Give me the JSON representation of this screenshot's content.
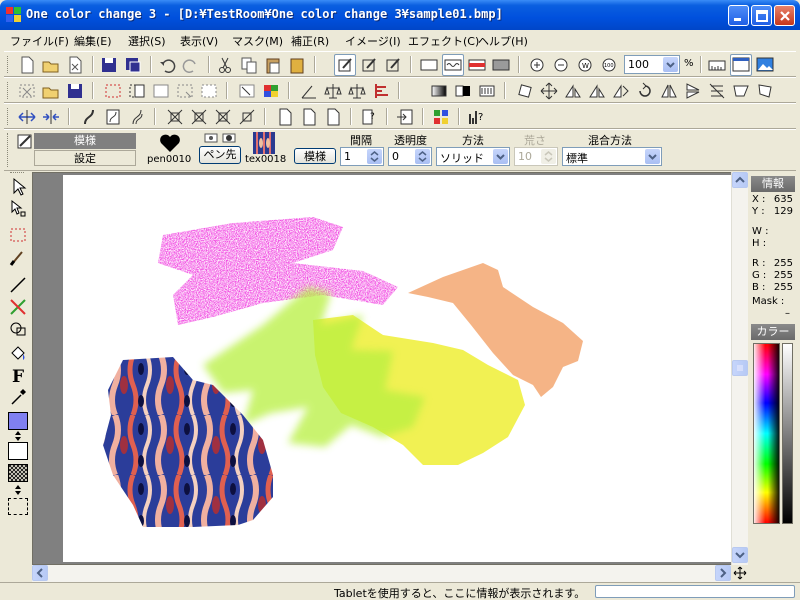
{
  "window": {
    "title": "One color change 3 - [D:¥TestRoom¥One color change 3¥sample01.bmp]"
  },
  "menu": [
    "ファイル(F)",
    "編集(E)",
    "選択(S)",
    "表示(V)",
    "マスク(M)",
    "補正(R)",
    "イメージ(I)",
    "エフェクト(C)",
    "ヘルプ(H)"
  ],
  "toolbar": {
    "zoom_value": "100",
    "zoom_unit": "%"
  },
  "options": {
    "pattern_label": "模様",
    "settings_label": "設定",
    "pen_name": "pen0010",
    "pen_tip_button": "ペン先",
    "texture_name": "tex0018",
    "pattern_button": "模様",
    "interval_header": "間隔",
    "interval_value": "1",
    "opacity_header": "透明度",
    "opacity_value": "0",
    "method_header": "方法",
    "method_value": "ソリッド",
    "roughness_header": "荒さ",
    "roughness_value": "10",
    "blend_header": "混合方法",
    "blend_value": "標準"
  },
  "info_panel": {
    "title": "情報",
    "x_label": "X :",
    "x_value": "635",
    "y_label": "Y :",
    "y_value": "129",
    "w_label": "W :",
    "w_value": "",
    "h_label": "H :",
    "h_value": "",
    "r_label": "R :",
    "r_value": "255",
    "g_label": "G :",
    "g_value": "255",
    "b_label": "B :",
    "b_value": "255",
    "mask_label": "Mask :",
    "mask_value": "–"
  },
  "color_panel": {
    "title": "カラー"
  },
  "status": {
    "message": "Tabletを使用すると、ここに情報が表示されます。"
  },
  "colors": {
    "title_blue": "#0050dd",
    "stroke_magenta": "#f040e0",
    "stroke_lime": "#b8f040",
    "stroke_yellow": "#f0f040",
    "stroke_orange": "#f4b080",
    "fg_color": "#8080f0",
    "bg_color": "#ffffff"
  }
}
